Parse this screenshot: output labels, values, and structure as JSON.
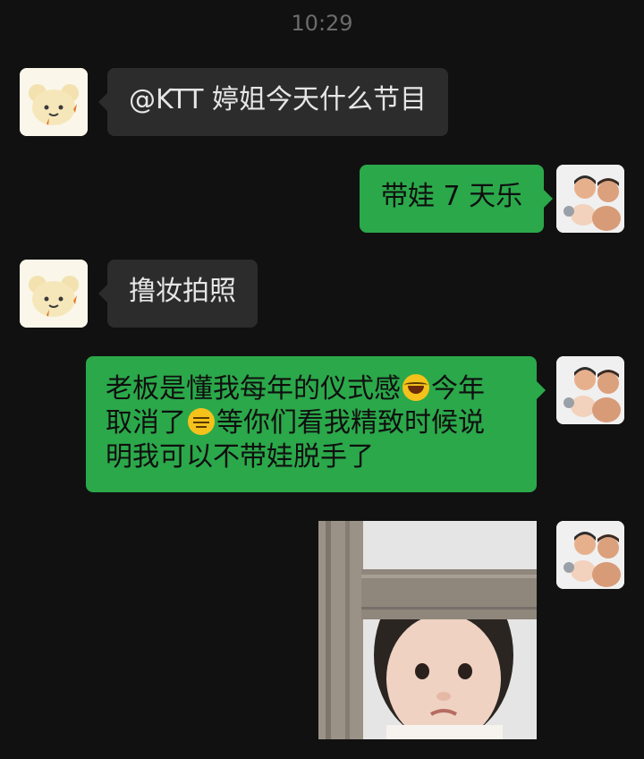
{
  "timestamp": "10:29",
  "messages": [
    {
      "sender": "other",
      "text": "@KTT 婷姐今天什么节目"
    },
    {
      "sender": "me",
      "text": "带娃 7 天乐"
    },
    {
      "sender": "other",
      "text": "撸妆拍照"
    },
    {
      "sender": "me",
      "line1a": "老板是懂我每年的仪式感",
      "line1b": "今年",
      "line2a": "取消了",
      "line2b": "等你们看我精致时候说",
      "line3": "明我可以不带娃脱手了"
    },
    {
      "sender": "me",
      "type": "image"
    }
  ],
  "icons": {
    "other_avatar": "sheep-avatar",
    "me_avatar": "family-photo-avatar",
    "emoji_1": "tears-of-joy-emoji",
    "emoji_2": "expressionless-emoji"
  }
}
